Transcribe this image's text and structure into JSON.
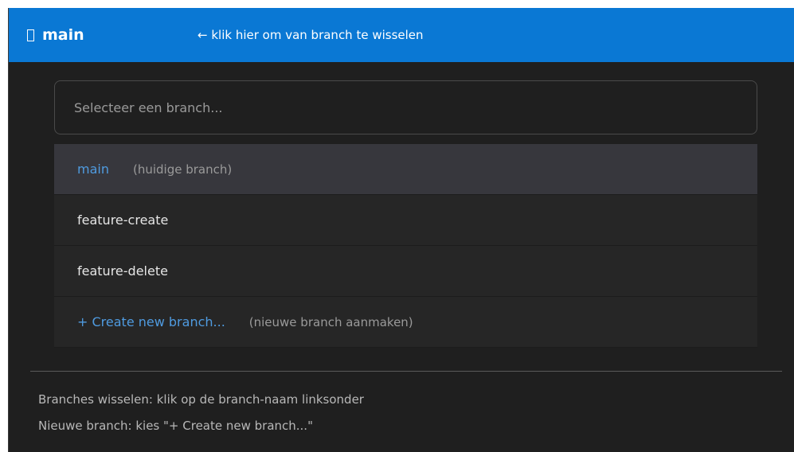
{
  "header": {
    "branch_icon": "branch-icon",
    "current_branch": "main",
    "hint": "← klik hier om van branch te wisselen",
    "accent_color": "#0a78d4"
  },
  "picker": {
    "placeholder": "Selecteer een branch...",
    "items": [
      {
        "label": "main",
        "note": "(huidige branch)",
        "current": true
      },
      {
        "label": "feature-create",
        "note": ""
      },
      {
        "label": "feature-delete",
        "note": ""
      },
      {
        "label": "+ Create new branch...",
        "note": "(nieuwe branch aanmaken)"
      }
    ]
  },
  "footer": {
    "line1": "Branches wisselen: klik op de branch-naam linksonder",
    "line2": "Nieuwe branch: kies \"+ Create new branch...\""
  }
}
